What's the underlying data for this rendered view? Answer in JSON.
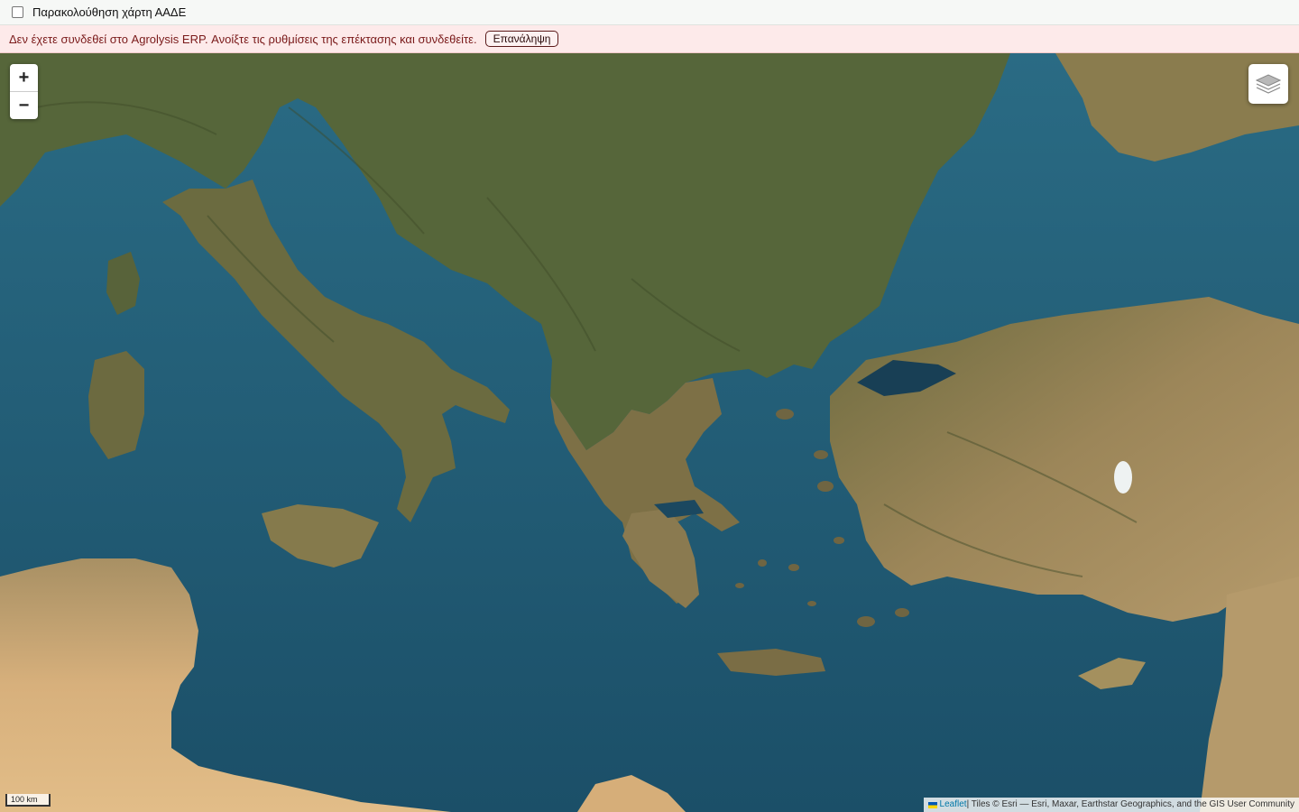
{
  "topbar": {
    "checkbox_label": "Παρακολούθηση χάρτη ΑΑΔΕ",
    "checked": false
  },
  "alert": {
    "message": "Δεν έχετε συνδεθεί στο Agrolysis ERP. Ανοίξτε τις ρυθμίσεις της επέκτασης και συνδεθείτε.",
    "retry_label": "Επανάληψη"
  },
  "map": {
    "zoom_in_label": "+",
    "zoom_out_label": "−",
    "scale_label": "100 km",
    "attribution": {
      "leaflet_link": "Leaflet",
      "tiles_text": " | Tiles © Esri — Esri, Maxar, Earthstar Geographics, and the GIS User Community"
    },
    "layer_control_icon": "layers-icon",
    "colors": {
      "sea": "#1e5b74",
      "land_green": "#56663a",
      "land_tan": "#a38b5e",
      "desert": "#d9b27e"
    }
  }
}
